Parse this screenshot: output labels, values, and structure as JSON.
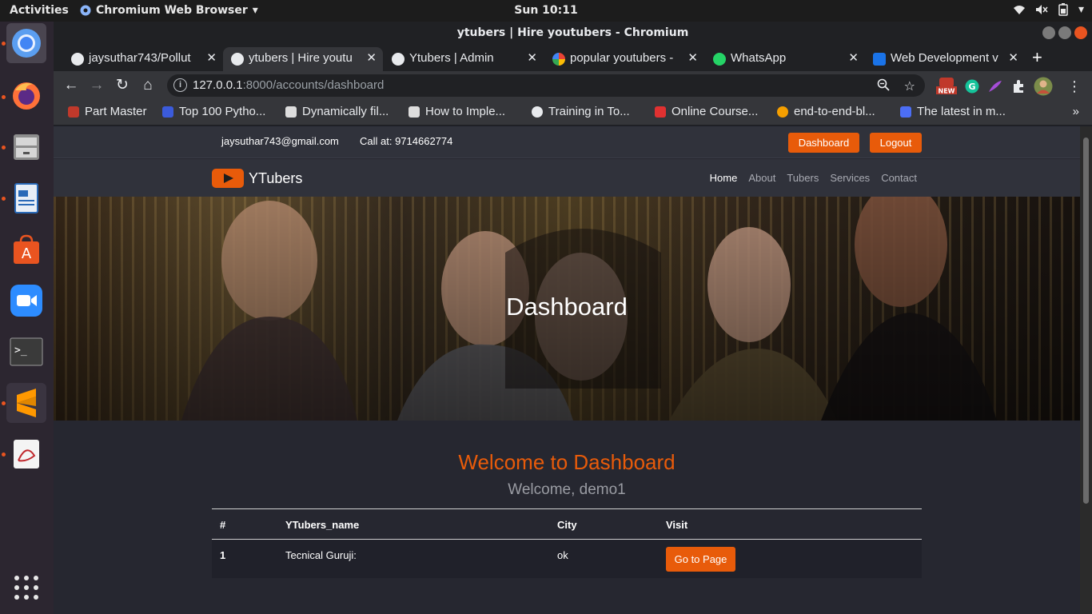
{
  "system": {
    "activities": "Activities",
    "app_menu": "Chromium Web Browser",
    "clock": "Sun 10:11"
  },
  "window": {
    "title": "ytubers | Hire youtubers - Chromium"
  },
  "tabs": [
    {
      "label": "jaysuthar743/Pollut",
      "icon": "github-icon",
      "active": false
    },
    {
      "label": "ytubers | Hire youtu",
      "icon": "globe-icon",
      "active": true
    },
    {
      "label": "Ytubers | Admin",
      "icon": "globe-icon",
      "active": false
    },
    {
      "label": "popular youtubers -",
      "icon": "google-icon",
      "active": false
    },
    {
      "label": "WhatsApp",
      "icon": "whatsapp-icon",
      "active": false
    },
    {
      "label": "Web Development v",
      "icon": "is-icon",
      "active": false
    }
  ],
  "address": {
    "host": "127.0.0.1",
    "rest": ":8000/accounts/dashboard"
  },
  "bookmarks": [
    {
      "label": "Part Master",
      "color": "#c0392b"
    },
    {
      "label": "Top 100 Pytho...",
      "color": "#3b5bdb"
    },
    {
      "label": "Dynamically fil...",
      "color": "#dddddd"
    },
    {
      "label": "How to Imple...",
      "color": "#dddddd"
    },
    {
      "label": "Training in To...",
      "color": "#e8eaed"
    },
    {
      "label": "Online Course...",
      "color": "#e03131"
    },
    {
      "label": "end-to-end-bl...",
      "color": "#f59f00"
    },
    {
      "label": "The latest in m...",
      "color": "#4c6ef5"
    }
  ],
  "bookmarks_more": "»",
  "site": {
    "email": "jaysuthar743@gmail.com",
    "phone": "Call at: 9714662774",
    "dashboard_btn": "Dashboard",
    "logout_btn": "Logout",
    "brand": "YTubers",
    "nav": [
      "Home",
      "About",
      "Tubers",
      "Services",
      "Contact"
    ],
    "accent": "#e85b0a"
  },
  "hero": {
    "title": "Dashboard"
  },
  "main": {
    "welcome_title": "Welcome to Dashboard",
    "welcome_sub": "Welcome, demo1",
    "table": {
      "headers": [
        "#",
        "YTubers_name",
        "City",
        "Visit"
      ],
      "rows": [
        {
          "num": "1",
          "name": "Tecnical Guruji:",
          "city": "ok",
          "action": "Go to Page"
        }
      ]
    }
  }
}
